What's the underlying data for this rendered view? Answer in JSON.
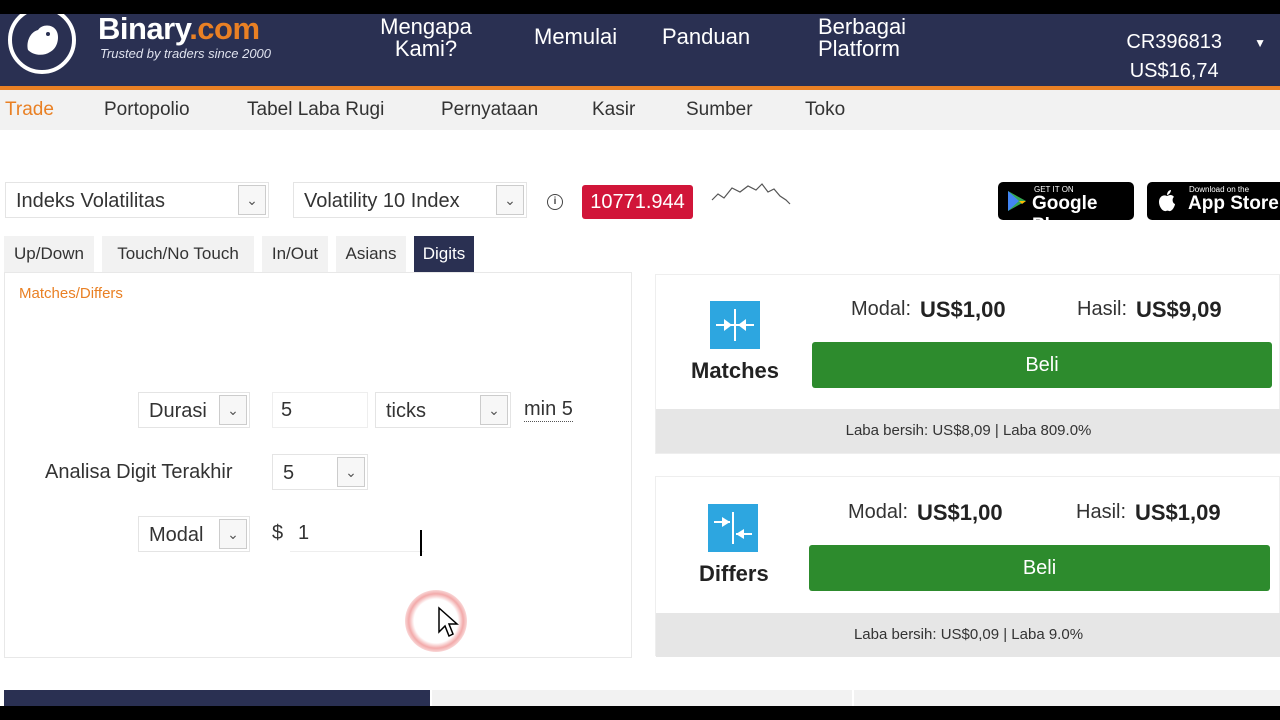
{
  "header": {
    "brand_name": "Binary",
    "brand_suffix": ".com",
    "tagline": "Trusted by traders since 2000",
    "nav": [
      "Mengapa Kami?",
      "Memulai",
      "Panduan",
      "Berbagai Platform"
    ],
    "account_id": "CR396813",
    "balance": "US$16,74"
  },
  "subnav": {
    "items": [
      "Trade",
      "Portopolio",
      "Tabel Laba Rugi",
      "Pernyataan",
      "Kasir",
      "Sumber",
      "Toko"
    ],
    "active": "Trade"
  },
  "market": {
    "category": "Indeks Volatilitas",
    "symbol": "Volatility 10 Index",
    "spot_price": "10771.944"
  },
  "stores": {
    "google_small": "GET IT ON",
    "google_big": "Google Play",
    "apple_small": "Download on the",
    "apple_big": "App Store"
  },
  "tabs": [
    "Up/Down",
    "Touch/No Touch",
    "In/Out",
    "Asians",
    "Digits"
  ],
  "active_tab": "Digits",
  "form": {
    "subtype": "Matches/Differs",
    "duration_label": "Durasi",
    "duration_value": "5",
    "duration_unit": "ticks",
    "duration_min": "min 5",
    "last_digit_label": "Analisa Digit Terakhir",
    "last_digit_value": "5",
    "amount_type": "Modal",
    "currency_symbol": "$",
    "amount_value": "1"
  },
  "contracts": [
    {
      "title": "Matches",
      "stake_label": "Modal:",
      "stake": "US$1,00",
      "payout_label": "Hasil:",
      "payout": "US$9,09",
      "buy_label": "Beli",
      "profit": "Laba bersih: US$8,09 | Laba 809.0%"
    },
    {
      "title": "Differs",
      "stake_label": "Modal:",
      "stake": "US$1,00",
      "payout_label": "Hasil:",
      "payout": "US$1,09",
      "buy_label": "Beli",
      "profit": "Laba bersih: US$0,09 | Laba 9.0%"
    }
  ],
  "colors": {
    "header_bg": "#2a3052",
    "accent_orange": "#e98024",
    "price_red": "#d11539",
    "buy_green": "#2d8b2d",
    "icon_blue": "#2da6e0"
  }
}
